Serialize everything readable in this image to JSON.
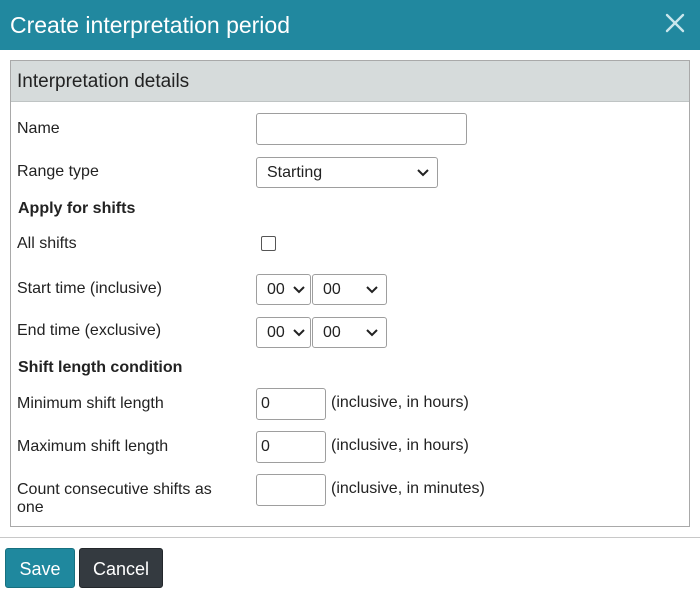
{
  "dialog": {
    "title": "Create interpretation period",
    "close_icon": "close-icon"
  },
  "panel": {
    "header": "Interpretation details",
    "name": {
      "label": "Name",
      "value": ""
    },
    "range_type": {
      "label": "Range type",
      "value": "Starting"
    },
    "apply_section": "Apply for shifts",
    "all_shifts": {
      "label": "All shifts",
      "checked": false
    },
    "start_time": {
      "label": "Start time (inclusive)",
      "hour": "00",
      "minute": "00"
    },
    "end_time": {
      "label": "End time (exclusive)",
      "hour": "00",
      "minute": "00"
    },
    "shift_section": "Shift length condition",
    "min_shift": {
      "label": "Minimum shift length",
      "value": "0",
      "hint": "(inclusive, in hours)"
    },
    "max_shift": {
      "label": "Maximum shift length",
      "value": "0",
      "hint": "(inclusive, in hours)"
    },
    "consecutive": {
      "label_line1": "Count consecutive shifts as",
      "label_line2": "one",
      "value": "",
      "hint": "(inclusive, in minutes)"
    }
  },
  "footer": {
    "save_label": "Save",
    "cancel_label": "Cancel"
  },
  "colors": {
    "titlebar": "#21889f",
    "panel_header": "#d6dbdb",
    "save_button": "#1f889e",
    "cancel_button": "#343a40"
  }
}
